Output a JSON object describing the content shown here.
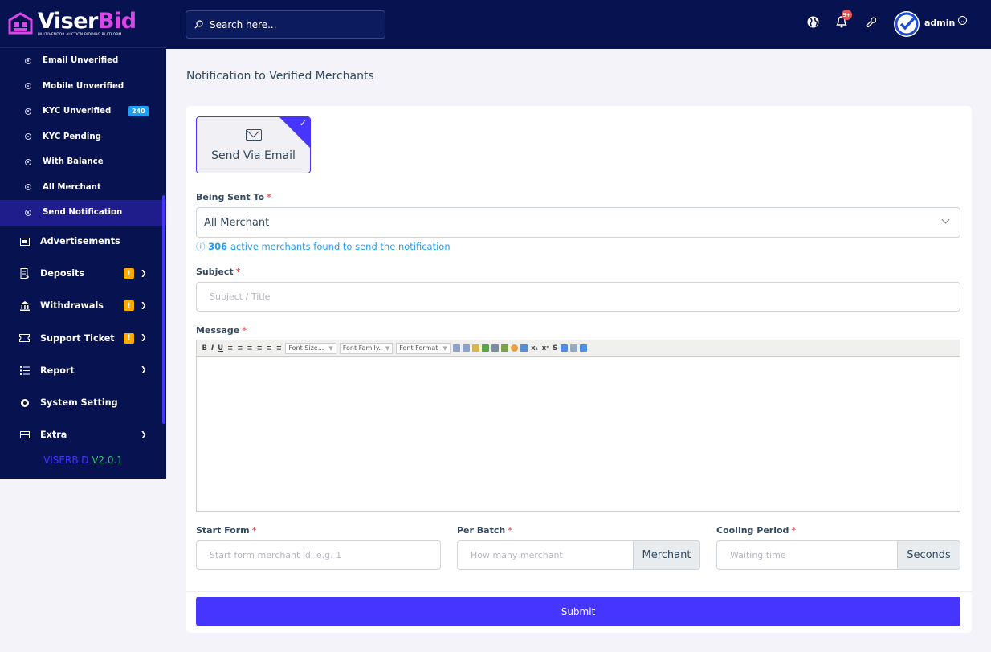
{
  "brand": {
    "name_part1": "Viser",
    "name_part2": "Bid",
    "tagline": "MULTIVENDOR AUCTION BIDDING PLATFORM",
    "accent": "#4634ff",
    "brand_pink": "#d947e6",
    "sidebar_bg": "#071251"
  },
  "sidebar": {
    "sub_items": [
      {
        "label": "Email Unverified"
      },
      {
        "label": "Mobile Unverified"
      },
      {
        "label": "KYC Unverified",
        "badge": "240"
      },
      {
        "label": "KYC Pending"
      },
      {
        "label": "With Balance"
      },
      {
        "label": "All Merchant"
      },
      {
        "label": "Send Notification",
        "active": true
      }
    ],
    "items": [
      {
        "label": "Advertisements",
        "icon": "ad-icon"
      },
      {
        "label": "Deposits",
        "icon": "deposit-icon",
        "warn": "!",
        "chevron": true
      },
      {
        "label": "Withdrawals",
        "icon": "bank-icon",
        "warn": "!",
        "chevron": true
      },
      {
        "label": "Support Ticket",
        "icon": "ticket-icon",
        "warn": "!",
        "chevron": true
      },
      {
        "label": "Report",
        "icon": "list-icon",
        "chevron": true
      },
      {
        "label": "System Setting",
        "icon": "gear-icon"
      },
      {
        "label": "Extra",
        "icon": "extra-icon",
        "chevron": true
      }
    ],
    "version_name": "VISERBID",
    "version_number": "V2.0.1"
  },
  "topbar": {
    "search_placeholder": "Search here...",
    "notification_count": "9+",
    "user": "admin"
  },
  "page": {
    "title": "Notification to Verified Merchants",
    "send_via": "Send Via Email",
    "being_sent_to_label": "Being Sent To",
    "being_sent_to_value": "All Merchant",
    "info_count": "306",
    "info_text": " active merchants found to send the notification",
    "subject_label": "Subject",
    "subject_placeholder": "Subject / Title",
    "message_label": "Message",
    "editor_toolbar": {
      "font_size": "Font Size...",
      "font_family": "Font Family.",
      "font_format": "Font Format"
    },
    "start_form_label": "Start Form",
    "start_form_placeholder": "Start form merchant id. e.g. 1",
    "per_batch_label": "Per Batch",
    "per_batch_placeholder": "How many merchant",
    "per_batch_addon": "Merchant",
    "cooling_label": "Cooling Period",
    "cooling_placeholder": "Waiting time",
    "cooling_addon": "Seconds",
    "submit_label": "Submit"
  }
}
